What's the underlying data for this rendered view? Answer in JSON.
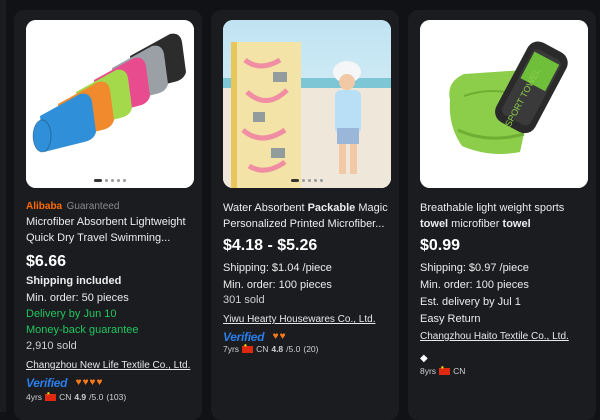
{
  "cards": [
    {
      "badge": {
        "brand": "Alibaba",
        "label": "Guaranteed"
      },
      "title_line1": "Microfiber Absorbent Lightweight",
      "title_line2": "Quick Dry Travel Swimming...",
      "price": "$6.66",
      "shipping": "Shipping included",
      "min_order": "Min. order: 50 pieces",
      "delivery": "Delivery by Jun 10",
      "guarantee": "Money-back guarantee",
      "sold": "2,910 sold",
      "supplier": "Changzhou New Life Textile Co., Ltd.",
      "verified": "Verified",
      "years": "4yrs",
      "country": "CN",
      "rating": "4.9",
      "rating_max": "/5.0",
      "reviews": "(103)",
      "level_icons": [
        "heart-icon",
        "heart-icon",
        "heart-icon",
        "heart-icon"
      ],
      "image_dots": 5,
      "towel_colors": [
        "#2f8fd8",
        "#f08a2c",
        "#a3d94b",
        "#e94b8f",
        "#9aa0a6",
        "#2c2c2c"
      ]
    },
    {
      "title_line1_pre": "Water Absorbent ",
      "title_line1_bold": "Packable",
      "title_line1_post": " Magic",
      "title_line2": "Personalized Printed Microfiber...",
      "price": "$4.18 - $5.26",
      "shipping": "Shipping: $1.04 /piece",
      "min_order": "Min. order: 100 pieces",
      "sold": "301 sold",
      "supplier": "Yiwu Hearty Housewares Co., Ltd.",
      "verified": "Verified",
      "years": "7yrs",
      "country": "CN",
      "rating": "4.8",
      "rating_max": "/5.0",
      "reviews": "(20)",
      "level_icons": [
        "heart-icon",
        "heart-icon"
      ],
      "image_dots": 5
    },
    {
      "title_line1": "Breathable light weight sports",
      "title_line2_bold1": "towel",
      "title_line2_mid": " microfiber ",
      "title_line2_bold2": "towel",
      "price": "$0.99",
      "shipping": "Shipping: $0.97 /piece",
      "min_order": "Min. order: 100 pieces",
      "delivery": "Est. delivery by Jul 1",
      "returns": "Easy Return",
      "supplier": "Changzhou Haito Textile Co., Ltd.",
      "years": "8yrs",
      "country": "CN",
      "level_icons": [
        "diamond-icon"
      ],
      "pouch_text": "SPORT TOWEL"
    }
  ]
}
